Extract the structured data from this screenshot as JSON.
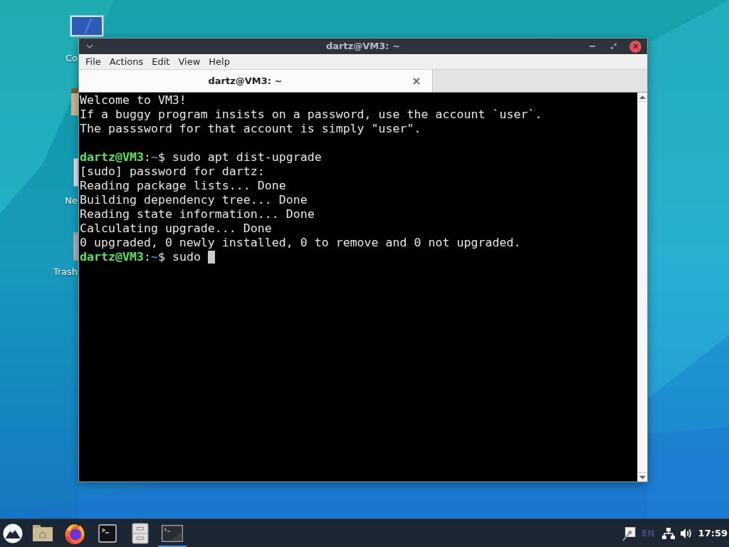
{
  "desktop": {
    "icons": [
      {
        "kind": "computer",
        "label": "Co"
      },
      {
        "kind": "home"
      },
      {
        "kind": "network",
        "label": "Ne"
      },
      {
        "kind": "trash",
        "label": "Trash"
      }
    ]
  },
  "window": {
    "title": "dartz@VM3: ~",
    "menu": [
      "File",
      "Actions",
      "Edit",
      "View",
      "Help"
    ],
    "tabs": [
      {
        "label": "dartz@VM3: ~",
        "selected": true
      }
    ],
    "terminal": {
      "lines": [
        {
          "kind": "output",
          "text": "Welcome to VM3!"
        },
        {
          "kind": "output",
          "text": "If a buggy program insists on a password, use the account `user`."
        },
        {
          "kind": "output",
          "text": "The passsword for that account is simply \"user\"."
        },
        {
          "kind": "blank"
        },
        {
          "kind": "prompt",
          "user": "dartz@VM3",
          "separator": ":",
          "path": "~",
          "sign": "$",
          "command": "sudo apt dist-upgrade"
        },
        {
          "kind": "output",
          "text": "[sudo] password for dartz:"
        },
        {
          "kind": "output",
          "text": "Reading package lists... Done"
        },
        {
          "kind": "output",
          "text": "Building dependency tree... Done"
        },
        {
          "kind": "output",
          "text": "Reading state information... Done"
        },
        {
          "kind": "output",
          "text": "Calculating upgrade... Done"
        },
        {
          "kind": "output",
          "text": "0 upgraded, 0 newly installed, 0 to remove and 0 not upgraded."
        },
        {
          "kind": "prompt",
          "user": "dartz@VM3",
          "separator": ":",
          "path": "~",
          "sign": "$",
          "command": "sudo",
          "cursor": true
        }
      ]
    }
  },
  "taskbar": {
    "tasks": [
      {
        "selected": true
      }
    ],
    "language": "EN",
    "clock": "17:59"
  }
}
